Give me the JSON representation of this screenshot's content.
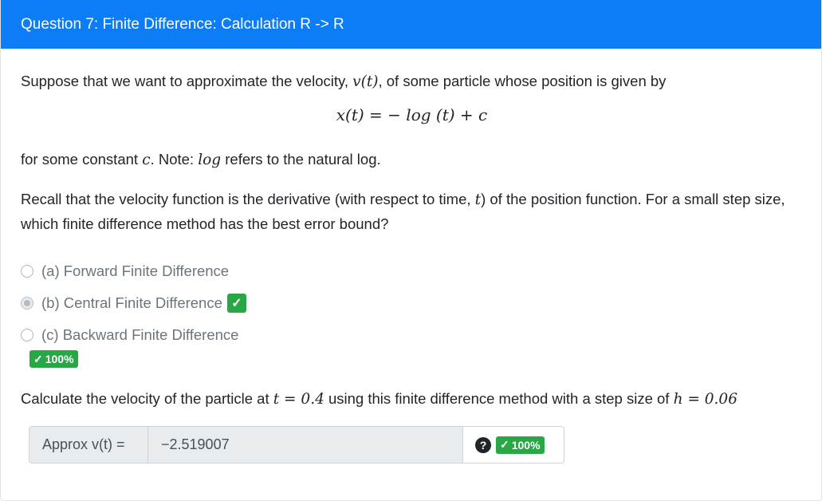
{
  "header": {
    "title": "Question 7: Finite Difference: Calculation R -> R"
  },
  "prompt": {
    "p1_pre": "Suppose that we want to approximate the velocity, ",
    "p1_var": "v(t)",
    "p1_post": ", of some particle whose position is given by",
    "equation": "x(t) = − log (t) + c",
    "p2_pre": "for some constant ",
    "p2_c": "c",
    "p2_mid": ". Note: ",
    "p2_log": "log",
    "p2_post": " refers to the natural log.",
    "p3_pre": "Recall that the velocity function is the derivative (with respect to time, ",
    "p3_t": "t",
    "p3_post": ") of the position function. For a small step size, which finite difference method has the best error bound?"
  },
  "options": [
    {
      "label": "(a) Forward Finite Difference",
      "selected": false
    },
    {
      "label": "(b) Central Finite Difference",
      "selected": true,
      "correct": true
    },
    {
      "label": "(c) Backward Finite Difference",
      "selected": false
    }
  ],
  "part1_score": "100%",
  "part2": {
    "text_pre": "Calculate the velocity of the particle at ",
    "t_expr": "t = 0.4",
    "text_mid": " using this finite difference method with a step size of ",
    "h_expr": "h = 0.06",
    "input_label": "Approx v(t) =",
    "input_value": "−2.519007",
    "score": "100%"
  },
  "icons": {
    "check": "check-icon",
    "help": "question-circle-icon"
  },
  "colors": {
    "header": "#0d7df7",
    "success": "#28a745"
  }
}
